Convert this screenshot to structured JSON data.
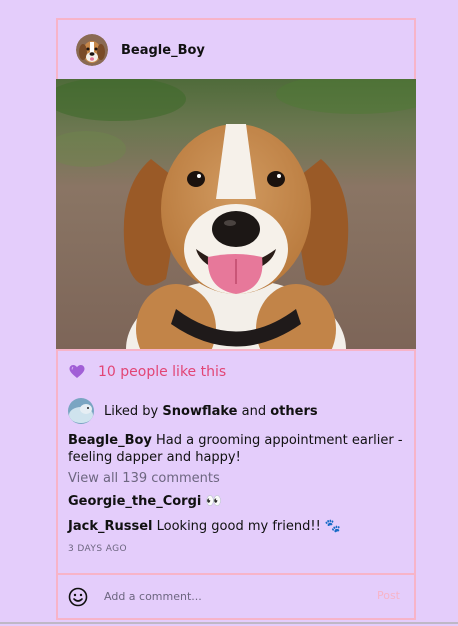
{
  "post": {
    "username": "Beagle_Boy",
    "likes_text": "10 people like this",
    "liked_by": {
      "prefix": "Liked by",
      "user": "Snowflake",
      "conjunction": "and",
      "others": "others"
    },
    "caption": {
      "user": "Beagle_Boy",
      "text": "Had a grooming appointment earlier - feeling dapper and happy!"
    },
    "view_all_comments": "View all 139 comments",
    "comments": [
      {
        "user": "Georgie_the_Corgi",
        "text": "👀"
      },
      {
        "user": "Jack_Russel",
        "text": "Looking good my friend!! 🐾"
      }
    ],
    "timestamp": "3 DAYS AGO"
  },
  "footer": {
    "placeholder": "Add a comment...",
    "post_label": "Post"
  },
  "icons": {
    "heart": "purple-heart-icon",
    "smiley": "smiley-icon"
  },
  "colors": {
    "background": "#e4cdfb",
    "border": "#f7b4c8",
    "likes_text": "#e24575"
  }
}
